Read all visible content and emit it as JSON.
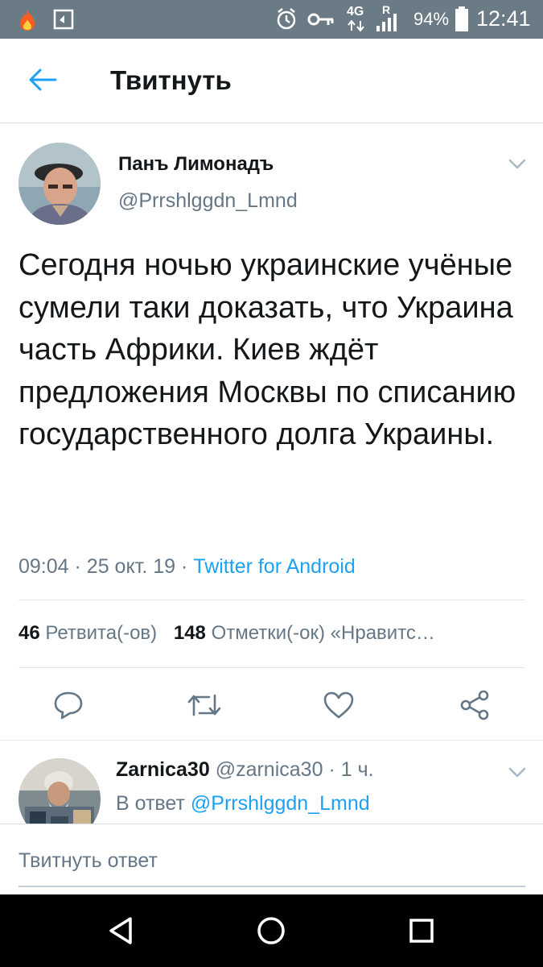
{
  "status_bar": {
    "network": "4G",
    "roaming": "R",
    "battery": "94%",
    "time": "12:41",
    "icons": [
      "flame-icon",
      "screenshot-icon",
      "alarm-icon",
      "key-icon",
      "signal-icon",
      "battery-icon"
    ]
  },
  "header": {
    "back_icon": "arrow-left-icon",
    "title": "Твитнуть"
  },
  "tweet": {
    "author_name": "Панъ Лимонадъ",
    "author_handle": "@Prrshlggdn_Lmnd",
    "text": "Сегодня ночью украинские учёные сумели таки доказать, что Украина часть Африки. Киев ждёт предложения Москвы по списанию государственного долга Украины.",
    "time": "09:04",
    "sep1": "·",
    "date": "25 окт. 19",
    "sep2": "·",
    "source": "Twitter for Android",
    "retweets_count": "46",
    "retweets_label": "Ретвита(-ов)",
    "likes_count": "148",
    "likes_label": "Отметки(-ок) «Нравитс…"
  },
  "actions": [
    "reply-icon",
    "retweet-icon",
    "like-icon",
    "share-icon"
  ],
  "reply": {
    "name": "Zarnica30",
    "handle": "@zarnica30",
    "sep": "·",
    "age": "1 ч.",
    "in_reply_prefix": "В ответ",
    "in_reply_handle": "@Prrshlggdn_Lmnd"
  },
  "compose": {
    "placeholder": "Твитнуть ответ"
  },
  "nav": [
    "back-triangle-icon",
    "home-circle-icon",
    "recents-square-icon"
  ],
  "colors": {
    "accent": "#1da1f2",
    "status_bar": "#6a7b86",
    "secondary_text": "#657786",
    "primary_text": "#14171a"
  }
}
